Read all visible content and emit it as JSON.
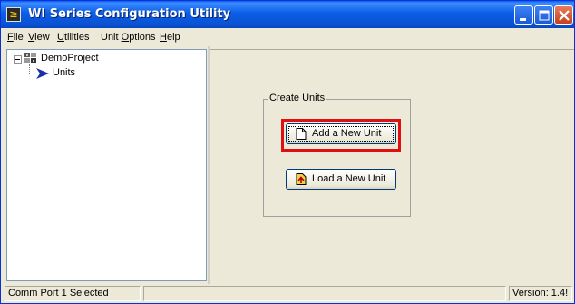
{
  "window": {
    "title": "WI Series Configuration Utility",
    "app_icon_glyph": "≥"
  },
  "title_buttons": [
    "minimize-icon",
    "maximize-icon",
    "close-icon"
  ],
  "menu": {
    "items": [
      {
        "label": "File",
        "mnemonic": "F"
      },
      {
        "label": "View",
        "mnemonic": "V"
      },
      {
        "label": "Utilities",
        "mnemonic": "U"
      },
      {
        "label": "Unit Options",
        "mnemonic": "O"
      },
      {
        "label": "Help",
        "mnemonic": "H"
      }
    ]
  },
  "tree": {
    "root": {
      "label": "DemoProject",
      "icon": "project-icon",
      "expanded": true
    },
    "child": {
      "label": "Units",
      "icon": "arrow-right-icon"
    }
  },
  "create_units": {
    "group_label": "Create Units",
    "add_button": {
      "label": "Add a New Unit",
      "icon": "new-document-icon",
      "highlighted": true
    },
    "load_button": {
      "label": "Load a New Unit",
      "icon": "load-unit-icon"
    }
  },
  "statusbar": {
    "port": "Comm Port 1 Selected",
    "version": "Version: 1.4!"
  },
  "colors": {
    "title_bar": "#0a54d6",
    "highlight_border": "#e01010",
    "window_bg": "#ece9d8"
  }
}
